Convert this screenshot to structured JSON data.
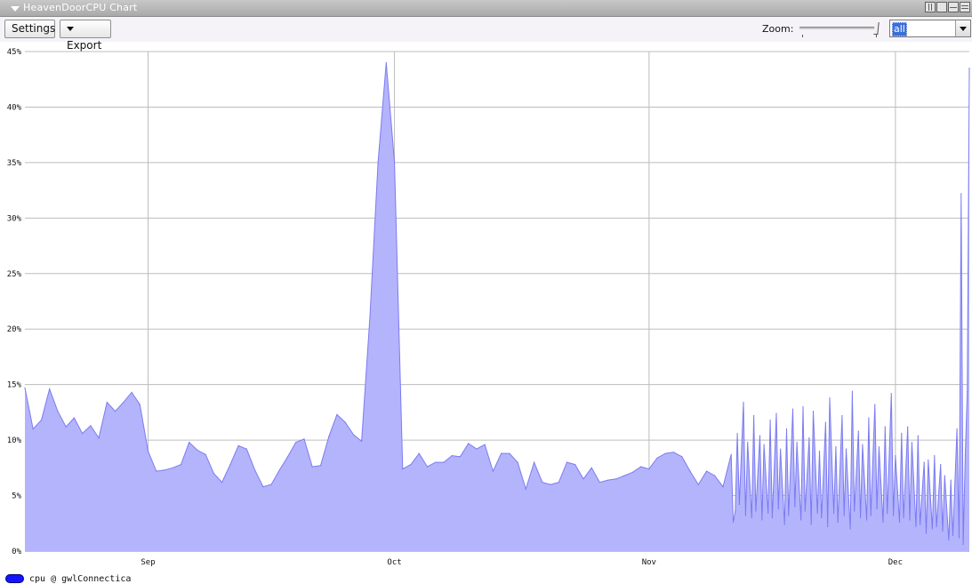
{
  "window": {
    "title": "HeavenDoorCPU Chart"
  },
  "toolbar": {
    "settings_label": "Settings",
    "export_label": "Export",
    "zoom_label": "Zoom:",
    "zoom_select_value": "all"
  },
  "colors": {
    "area_fill": "#b4b4fc",
    "area_stroke": "#7b7bf2",
    "grid": "#bdbdbd",
    "legend_swatch": "#1515ff"
  },
  "chart_data": {
    "type": "area",
    "ylim": [
      0,
      45
    ],
    "y_ticks": [
      "0%",
      "5%",
      "10%",
      "15%",
      "20%",
      "25%",
      "30%",
      "35%",
      "40%",
      "45%"
    ],
    "y_tick_values": [
      0,
      5,
      10,
      15,
      20,
      25,
      30,
      35,
      40,
      45
    ],
    "x_range": [
      "2022-08-17",
      "2022-12-10"
    ],
    "x_ticks": [
      {
        "label": "Sep",
        "date": "2022-09-01"
      },
      {
        "label": "Oct",
        "date": "2022-10-01"
      },
      {
        "label": "Nov",
        "date": "2022-11-01"
      },
      {
        "label": "Dec",
        "date": "2022-12-01"
      }
    ],
    "grid": true,
    "legend_position": "bottom-left",
    "series": [
      {
        "name": "cpu @ gwlConnectica",
        "points": [
          [
            "2022-08-17",
            14.7
          ],
          [
            "2022-08-18",
            11.0
          ],
          [
            "2022-08-19",
            11.8
          ],
          [
            "2022-08-20",
            14.6
          ],
          [
            "2022-08-21",
            12.6
          ],
          [
            "2022-08-22",
            11.2
          ],
          [
            "2022-08-23",
            12.0
          ],
          [
            "2022-08-24",
            10.6
          ],
          [
            "2022-08-25",
            11.3
          ],
          [
            "2022-08-26",
            10.2
          ],
          [
            "2022-08-27",
            13.4
          ],
          [
            "2022-08-28",
            12.6
          ],
          [
            "2022-08-29",
            13.4
          ],
          [
            "2022-08-30",
            14.3
          ],
          [
            "2022-08-31",
            13.2
          ],
          [
            "2022-09-01",
            9.0
          ],
          [
            "2022-09-02",
            7.2
          ],
          [
            "2022-09-03",
            7.3
          ],
          [
            "2022-09-04",
            7.5
          ],
          [
            "2022-09-05",
            7.8
          ],
          [
            "2022-09-06",
            9.8
          ],
          [
            "2022-09-07",
            9.1
          ],
          [
            "2022-09-08",
            8.7
          ],
          [
            "2022-09-09",
            7.0
          ],
          [
            "2022-09-10",
            6.2
          ],
          [
            "2022-09-11",
            7.8
          ],
          [
            "2022-09-12",
            9.5
          ],
          [
            "2022-09-13",
            9.2
          ],
          [
            "2022-09-14",
            7.3
          ],
          [
            "2022-09-15",
            5.8
          ],
          [
            "2022-09-16",
            6.0
          ],
          [
            "2022-09-17",
            7.3
          ],
          [
            "2022-09-18",
            8.5
          ],
          [
            "2022-09-19",
            9.8
          ],
          [
            "2022-09-20",
            10.1
          ],
          [
            "2022-09-21",
            7.6
          ],
          [
            "2022-09-22",
            7.7
          ],
          [
            "2022-09-23",
            10.3
          ],
          [
            "2022-09-24",
            12.3
          ],
          [
            "2022-09-25",
            11.6
          ],
          [
            "2022-09-26",
            10.5
          ],
          [
            "2022-09-27",
            9.9
          ],
          [
            "2022-09-28",
            21.0
          ],
          [
            "2022-09-29",
            35.0
          ],
          [
            "2022-09-30",
            44.0
          ],
          [
            "2022-10-01",
            35.0
          ],
          [
            "2022-10-02",
            7.4
          ],
          [
            "2022-10-03",
            7.8
          ],
          [
            "2022-10-04",
            8.8
          ],
          [
            "2022-10-05",
            7.6
          ],
          [
            "2022-10-06",
            8.0
          ],
          [
            "2022-10-07",
            8.0
          ],
          [
            "2022-10-08",
            8.6
          ],
          [
            "2022-10-09",
            8.5
          ],
          [
            "2022-10-10",
            9.7
          ],
          [
            "2022-10-11",
            9.2
          ],
          [
            "2022-10-12",
            9.6
          ],
          [
            "2022-10-13",
            7.2
          ],
          [
            "2022-10-14",
            8.8
          ],
          [
            "2022-10-15",
            8.8
          ],
          [
            "2022-10-16",
            8.0
          ],
          [
            "2022-10-17",
            5.6
          ],
          [
            "2022-10-18",
            8.0
          ],
          [
            "2022-10-19",
            6.2
          ],
          [
            "2022-10-20",
            6.0
          ],
          [
            "2022-10-21",
            6.2
          ],
          [
            "2022-10-22",
            8.0
          ],
          [
            "2022-10-23",
            7.8
          ],
          [
            "2022-10-24",
            6.5
          ],
          [
            "2022-10-25",
            7.5
          ],
          [
            "2022-10-26",
            6.2
          ],
          [
            "2022-10-27",
            6.4
          ],
          [
            "2022-10-28",
            6.5
          ],
          [
            "2022-10-29",
            6.8
          ],
          [
            "2022-10-30",
            7.1
          ],
          [
            "2022-10-31",
            7.6
          ],
          [
            "2022-11-01",
            7.4
          ],
          [
            "2022-11-02",
            8.4
          ],
          [
            "2022-11-03",
            8.8
          ],
          [
            "2022-11-04",
            8.9
          ],
          [
            "2022-11-05",
            8.5
          ],
          [
            "2022-11-06",
            7.2
          ],
          [
            "2022-11-07",
            6.0
          ],
          [
            "2022-11-08",
            7.2
          ],
          [
            "2022-11-09",
            6.8
          ],
          [
            "2022-11-10",
            5.8
          ],
          [
            "2022-11-11",
            8.7
          ],
          [
            "2022-11-11 06:00",
            2.6
          ],
          [
            "2022-11-11 12:00",
            3.6
          ],
          [
            "2022-11-11 18:00",
            10.6
          ],
          [
            "2022-11-12",
            4.2
          ],
          [
            "2022-11-12 12:00",
            13.4
          ],
          [
            "2022-11-12 18:00",
            3.2
          ],
          [
            "2022-11-13",
            9.8
          ],
          [
            "2022-11-13 12:00",
            3.0
          ],
          [
            "2022-11-13 18:00",
            12.2
          ],
          [
            "2022-11-14",
            3.6
          ],
          [
            "2022-11-14 12:00",
            10.4
          ],
          [
            "2022-11-14 18:00",
            2.8
          ],
          [
            "2022-11-15",
            9.6
          ],
          [
            "2022-11-15 12:00",
            3.4
          ],
          [
            "2022-11-15 18:00",
            11.8
          ],
          [
            "2022-11-16",
            3.0
          ],
          [
            "2022-11-16 12:00",
            12.4
          ],
          [
            "2022-11-16 18:00",
            3.8
          ],
          [
            "2022-11-17",
            9.2
          ],
          [
            "2022-11-17 12:00",
            2.4
          ],
          [
            "2022-11-17 18:00",
            11.0
          ],
          [
            "2022-11-18",
            3.2
          ],
          [
            "2022-11-18 12:00",
            12.8
          ],
          [
            "2022-11-18 18:00",
            4.0
          ],
          [
            "2022-11-19",
            9.8
          ],
          [
            "2022-11-19 12:00",
            2.8
          ],
          [
            "2022-11-19 18:00",
            13.0
          ],
          [
            "2022-11-20",
            3.6
          ],
          [
            "2022-11-20 12:00",
            10.2
          ],
          [
            "2022-11-20 18:00",
            2.4
          ],
          [
            "2022-11-21",
            12.6
          ],
          [
            "2022-11-21 12:00",
            3.4
          ],
          [
            "2022-11-21 18:00",
            9.0
          ],
          [
            "2022-11-22",
            3.0
          ],
          [
            "2022-11-22 12:00",
            11.6
          ],
          [
            "2022-11-22 18:00",
            2.2
          ],
          [
            "2022-11-23",
            13.8
          ],
          [
            "2022-11-23 12:00",
            3.4
          ],
          [
            "2022-11-23 18:00",
            9.4
          ],
          [
            "2022-11-24",
            2.6
          ],
          [
            "2022-11-24 12:00",
            12.2
          ],
          [
            "2022-11-24 18:00",
            3.2
          ],
          [
            "2022-11-25",
            9.2
          ],
          [
            "2022-11-25 12:00",
            2.0
          ],
          [
            "2022-11-25 18:00",
            14.4
          ],
          [
            "2022-11-26",
            3.6
          ],
          [
            "2022-11-26 12:00",
            10.8
          ],
          [
            "2022-11-26 18:00",
            3.0
          ],
          [
            "2022-11-27",
            9.6
          ],
          [
            "2022-11-27 12:00",
            2.8
          ],
          [
            "2022-11-27 18:00",
            12.0
          ],
          [
            "2022-11-28",
            3.2
          ],
          [
            "2022-11-28 12:00",
            13.2
          ],
          [
            "2022-11-28 18:00",
            3.8
          ],
          [
            "2022-11-29",
            9.4
          ],
          [
            "2022-11-29 12:00",
            2.6
          ],
          [
            "2022-11-29 18:00",
            11.2
          ],
          [
            "2022-11-30",
            3.4
          ],
          [
            "2022-11-30 12:00",
            14.2
          ],
          [
            "2022-11-30 18:00",
            3.2
          ],
          [
            "2022-12-01",
            8.6
          ],
          [
            "2022-12-01 12:00",
            2.6
          ],
          [
            "2022-12-01 18:00",
            10.6
          ],
          [
            "2022-12-02",
            3.0
          ],
          [
            "2022-12-02 12:00",
            11.2
          ],
          [
            "2022-12-02 18:00",
            2.8
          ],
          [
            "2022-12-03",
            9.8
          ],
          [
            "2022-12-03 12:00",
            2.2
          ],
          [
            "2022-12-03 18:00",
            10.4
          ],
          [
            "2022-12-04",
            2.4
          ],
          [
            "2022-12-04 12:00",
            8.0
          ],
          [
            "2022-12-04 18:00",
            1.6
          ],
          [
            "2022-12-05",
            8.2
          ],
          [
            "2022-12-05 12:00",
            2.0
          ],
          [
            "2022-12-05 18:00",
            8.6
          ],
          [
            "2022-12-06",
            2.2
          ],
          [
            "2022-12-06 12:00",
            7.8
          ],
          [
            "2022-12-06 18:00",
            1.8
          ],
          [
            "2022-12-07",
            6.8
          ],
          [
            "2022-12-07 12:00",
            1.0
          ],
          [
            "2022-12-07 18:00",
            6.4
          ],
          [
            "2022-12-08",
            1.4
          ],
          [
            "2022-12-08 12:00",
            11.0
          ],
          [
            "2022-12-08 18:00",
            1.2
          ],
          [
            "2022-12-09",
            32.2
          ],
          [
            "2022-12-09 06:00",
            0.6
          ],
          [
            "2022-12-09 12:00",
            8.6
          ],
          [
            "2022-12-09 18:00",
            14.4
          ],
          [
            "2022-12-10",
            43.5
          ]
        ]
      }
    ]
  }
}
